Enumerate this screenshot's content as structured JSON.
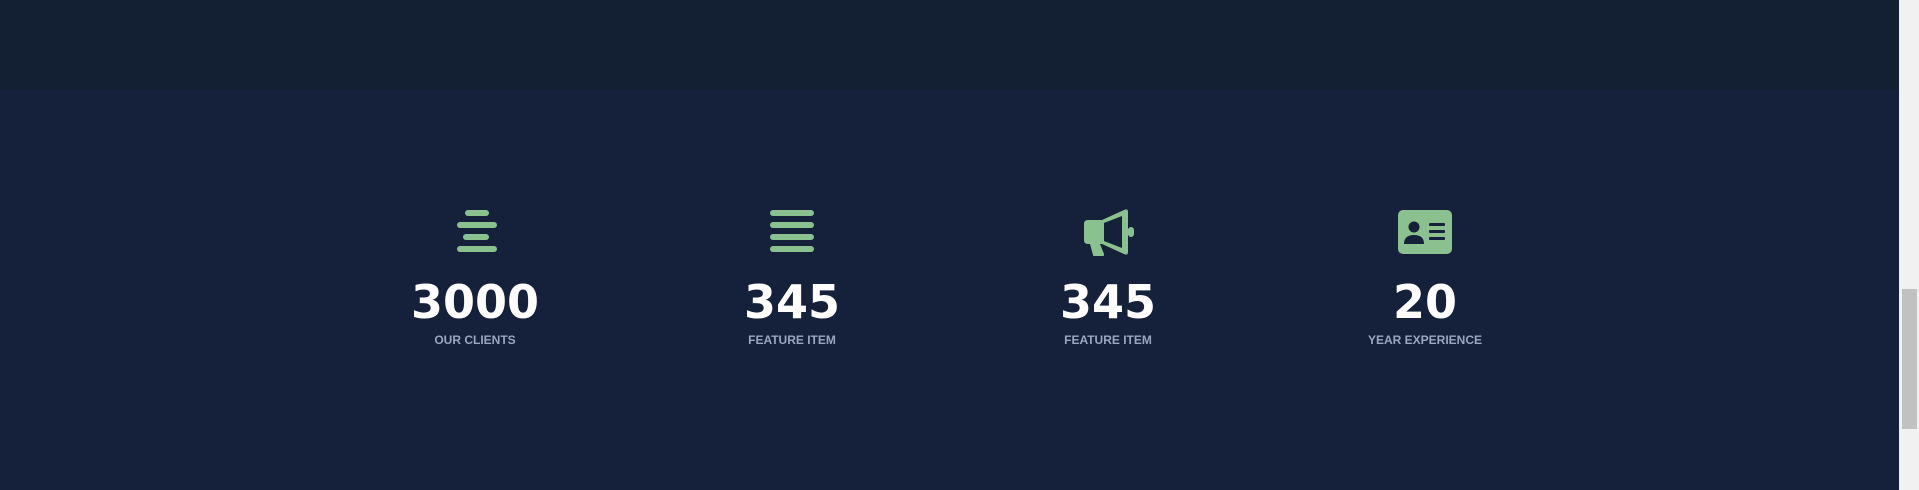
{
  "accent_color": "#8bc18f",
  "stats": [
    {
      "icon": "align-center-icon",
      "value": "3000",
      "label": "OUR CLIENTS"
    },
    {
      "icon": "list-bars-icon",
      "value": "345",
      "label": "FEATURE ITEM"
    },
    {
      "icon": "megaphone-icon",
      "value": "345",
      "label": "FEATURE ITEM"
    },
    {
      "icon": "id-card-icon",
      "value": "20",
      "label": "YEAR EXPERIENCE"
    }
  ]
}
